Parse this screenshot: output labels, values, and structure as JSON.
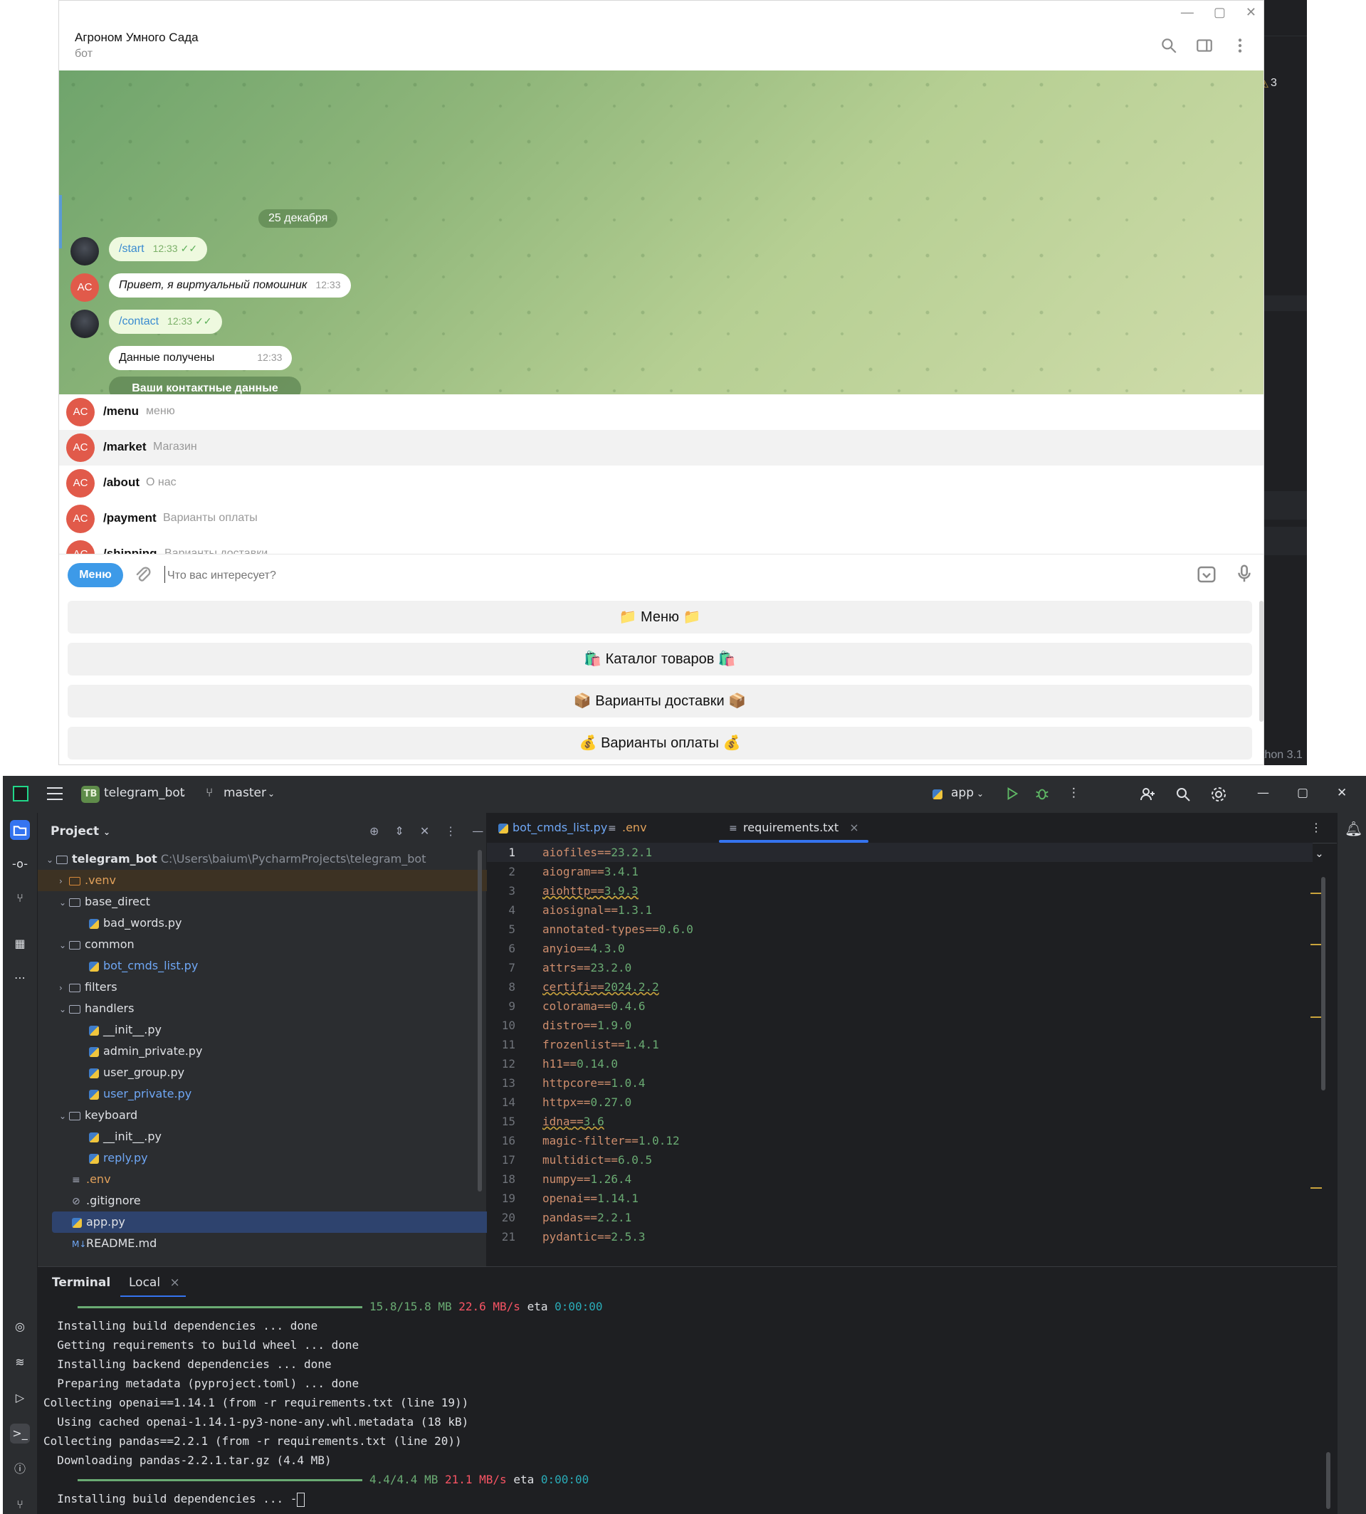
{
  "background_window": {
    "warning_count": "3",
    "status_text": "thon 3.1"
  },
  "telegram": {
    "chat_title": "Агроном Умного Сада",
    "chat_subtitle": "бот",
    "date": "25 декабря",
    "messages": [
      {
        "text": "/start",
        "time": "12:33"
      },
      {
        "avatar": "AC",
        "text": "Привет, я виртуальный помошник",
        "time": "12:33"
      },
      {
        "text": "/contact",
        "time": "12:33"
      },
      {
        "text": "Данные получены",
        "time": "12:33"
      },
      {
        "text": "Ваши контактные данные"
      }
    ],
    "commands": [
      {
        "avatar": "AC",
        "name": "/menu",
        "desc": "меню"
      },
      {
        "avatar": "AC",
        "name": "/market",
        "desc": "Магазин"
      },
      {
        "avatar": "AC",
        "name": "/about",
        "desc": "О нас"
      },
      {
        "avatar": "AC",
        "name": "/payment",
        "desc": "Варианты оплаты"
      },
      {
        "avatar": "AC",
        "name": "/shipping",
        "desc": "Варианты доставки"
      }
    ],
    "menu_button": "Меню",
    "input_placeholder": "Что вас интересует?",
    "keyboard": [
      "📁 Меню 📁",
      "🛍️ Каталог товаров 🛍️",
      "📦 Варианты доставки 📦",
      "💰 Варианты оплаты 💰"
    ]
  },
  "pycharm": {
    "project_badge": "TB",
    "project_name": "telegram_bot",
    "branch": "master",
    "run_config": "app",
    "project_panel_title": "Project",
    "tree": {
      "root_name": "telegram_bot",
      "root_path": "C:\\Users\\baium\\PycharmProjects\\telegram_bot",
      "items": [
        ".venv",
        "base_direct",
        "bad_words.py",
        "common",
        "bot_cmds_list.py",
        "filters",
        "handlers",
        "__init__.py",
        "admin_private.py",
        "user_group.py",
        "user_private.py",
        "keyboard",
        "__init__.py",
        "reply.py",
        ".env",
        ".gitignore",
        "app.py",
        "README.md"
      ]
    },
    "tabs": [
      "bot_cmds_list.py",
      ".env",
      "requirements.txt"
    ],
    "warnings": "4",
    "code": [
      {
        "n": "1",
        "pkg": "aiofiles",
        "ver": "23.2.1"
      },
      {
        "n": "2",
        "pkg": "aiogram",
        "ver": "3.4.1"
      },
      {
        "n": "3",
        "pkg": "aiohttp",
        "ver": "3.9.3"
      },
      {
        "n": "4",
        "pkg": "aiosignal",
        "ver": "1.3.1"
      },
      {
        "n": "5",
        "pkg": "annotated-types",
        "ver": "0.6.0"
      },
      {
        "n": "6",
        "pkg": "anyio",
        "ver": "4.3.0"
      },
      {
        "n": "7",
        "pkg": "attrs",
        "ver": "23.2.0"
      },
      {
        "n": "8",
        "pkg": "certifi",
        "ver": "2024.2.2"
      },
      {
        "n": "9",
        "pkg": "colorama",
        "ver": "0.4.6"
      },
      {
        "n": "10",
        "pkg": "distro",
        "ver": "1.9.0"
      },
      {
        "n": "11",
        "pkg": "frozenlist",
        "ver": "1.4.1"
      },
      {
        "n": "12",
        "pkg": "h11",
        "ver": "0.14.0"
      },
      {
        "n": "13",
        "pkg": "httpcore",
        "ver": "1.0.4"
      },
      {
        "n": "14",
        "pkg": "httpx",
        "ver": "0.27.0"
      },
      {
        "n": "15",
        "pkg": "idna",
        "ver": "3.6"
      },
      {
        "n": "16",
        "pkg": "magic-filter",
        "ver": "1.0.12"
      },
      {
        "n": "17",
        "pkg": "multidict",
        "ver": "6.0.5"
      },
      {
        "n": "18",
        "pkg": "numpy",
        "ver": "1.26.4"
      },
      {
        "n": "19",
        "pkg": "openai",
        "ver": "1.14.1"
      },
      {
        "n": "20",
        "pkg": "pandas",
        "ver": "2.2.1"
      },
      {
        "n": "21",
        "pkg": "pydantic",
        "ver": "2.5.3"
      }
    ],
    "terminal_title": "Terminal",
    "terminal_tab": "Local",
    "terminal_lines": [
      {
        "size": "15.8/15.8 MB",
        "speed": "22.6 MB/s",
        "eta_label": "eta",
        "eta": "0:00:00"
      },
      "  Installing build dependencies ... done",
      "  Getting requirements to build wheel ... done",
      "  Installing backend dependencies ... done",
      "  Preparing metadata (pyproject.toml) ... done",
      "Collecting openai==1.14.1 (from -r requirements.txt (line 19))",
      "  Using cached openai-1.14.1-py3-none-any.whl.metadata (18 kB)",
      "Collecting pandas==2.2.1 (from -r requirements.txt (line 20))",
      "  Downloading pandas-2.2.1.tar.gz (4.4 MB)",
      {
        "size": "4.4/4.4 MB",
        "speed": "21.1 MB/s",
        "eta_label": "eta",
        "eta": "0:00:00"
      },
      "  Installing build dependencies ... -"
    ]
  }
}
